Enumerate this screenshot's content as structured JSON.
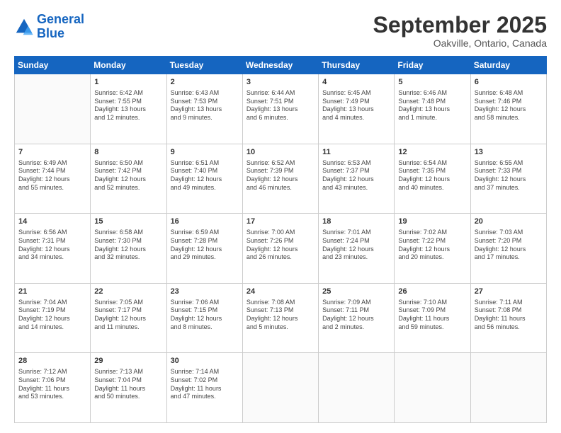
{
  "logo": {
    "line1": "General",
    "line2": "Blue"
  },
  "header": {
    "month": "September 2025",
    "location": "Oakville, Ontario, Canada"
  },
  "weekdays": [
    "Sunday",
    "Monday",
    "Tuesday",
    "Wednesday",
    "Thursday",
    "Friday",
    "Saturday"
  ],
  "weeks": [
    [
      {
        "day": "",
        "content": ""
      },
      {
        "day": "1",
        "content": "Sunrise: 6:42 AM\nSunset: 7:55 PM\nDaylight: 13 hours\nand 12 minutes."
      },
      {
        "day": "2",
        "content": "Sunrise: 6:43 AM\nSunset: 7:53 PM\nDaylight: 13 hours\nand 9 minutes."
      },
      {
        "day": "3",
        "content": "Sunrise: 6:44 AM\nSunset: 7:51 PM\nDaylight: 13 hours\nand 6 minutes."
      },
      {
        "day": "4",
        "content": "Sunrise: 6:45 AM\nSunset: 7:49 PM\nDaylight: 13 hours\nand 4 minutes."
      },
      {
        "day": "5",
        "content": "Sunrise: 6:46 AM\nSunset: 7:48 PM\nDaylight: 13 hours\nand 1 minute."
      },
      {
        "day": "6",
        "content": "Sunrise: 6:48 AM\nSunset: 7:46 PM\nDaylight: 12 hours\nand 58 minutes."
      }
    ],
    [
      {
        "day": "7",
        "content": "Sunrise: 6:49 AM\nSunset: 7:44 PM\nDaylight: 12 hours\nand 55 minutes."
      },
      {
        "day": "8",
        "content": "Sunrise: 6:50 AM\nSunset: 7:42 PM\nDaylight: 12 hours\nand 52 minutes."
      },
      {
        "day": "9",
        "content": "Sunrise: 6:51 AM\nSunset: 7:40 PM\nDaylight: 12 hours\nand 49 minutes."
      },
      {
        "day": "10",
        "content": "Sunrise: 6:52 AM\nSunset: 7:39 PM\nDaylight: 12 hours\nand 46 minutes."
      },
      {
        "day": "11",
        "content": "Sunrise: 6:53 AM\nSunset: 7:37 PM\nDaylight: 12 hours\nand 43 minutes."
      },
      {
        "day": "12",
        "content": "Sunrise: 6:54 AM\nSunset: 7:35 PM\nDaylight: 12 hours\nand 40 minutes."
      },
      {
        "day": "13",
        "content": "Sunrise: 6:55 AM\nSunset: 7:33 PM\nDaylight: 12 hours\nand 37 minutes."
      }
    ],
    [
      {
        "day": "14",
        "content": "Sunrise: 6:56 AM\nSunset: 7:31 PM\nDaylight: 12 hours\nand 34 minutes."
      },
      {
        "day": "15",
        "content": "Sunrise: 6:58 AM\nSunset: 7:30 PM\nDaylight: 12 hours\nand 32 minutes."
      },
      {
        "day": "16",
        "content": "Sunrise: 6:59 AM\nSunset: 7:28 PM\nDaylight: 12 hours\nand 29 minutes."
      },
      {
        "day": "17",
        "content": "Sunrise: 7:00 AM\nSunset: 7:26 PM\nDaylight: 12 hours\nand 26 minutes."
      },
      {
        "day": "18",
        "content": "Sunrise: 7:01 AM\nSunset: 7:24 PM\nDaylight: 12 hours\nand 23 minutes."
      },
      {
        "day": "19",
        "content": "Sunrise: 7:02 AM\nSunset: 7:22 PM\nDaylight: 12 hours\nand 20 minutes."
      },
      {
        "day": "20",
        "content": "Sunrise: 7:03 AM\nSunset: 7:20 PM\nDaylight: 12 hours\nand 17 minutes."
      }
    ],
    [
      {
        "day": "21",
        "content": "Sunrise: 7:04 AM\nSunset: 7:19 PM\nDaylight: 12 hours\nand 14 minutes."
      },
      {
        "day": "22",
        "content": "Sunrise: 7:05 AM\nSunset: 7:17 PM\nDaylight: 12 hours\nand 11 minutes."
      },
      {
        "day": "23",
        "content": "Sunrise: 7:06 AM\nSunset: 7:15 PM\nDaylight: 12 hours\nand 8 minutes."
      },
      {
        "day": "24",
        "content": "Sunrise: 7:08 AM\nSunset: 7:13 PM\nDaylight: 12 hours\nand 5 minutes."
      },
      {
        "day": "25",
        "content": "Sunrise: 7:09 AM\nSunset: 7:11 PM\nDaylight: 12 hours\nand 2 minutes."
      },
      {
        "day": "26",
        "content": "Sunrise: 7:10 AM\nSunset: 7:09 PM\nDaylight: 11 hours\nand 59 minutes."
      },
      {
        "day": "27",
        "content": "Sunrise: 7:11 AM\nSunset: 7:08 PM\nDaylight: 11 hours\nand 56 minutes."
      }
    ],
    [
      {
        "day": "28",
        "content": "Sunrise: 7:12 AM\nSunset: 7:06 PM\nDaylight: 11 hours\nand 53 minutes."
      },
      {
        "day": "29",
        "content": "Sunrise: 7:13 AM\nSunset: 7:04 PM\nDaylight: 11 hours\nand 50 minutes."
      },
      {
        "day": "30",
        "content": "Sunrise: 7:14 AM\nSunset: 7:02 PM\nDaylight: 11 hours\nand 47 minutes."
      },
      {
        "day": "",
        "content": ""
      },
      {
        "day": "",
        "content": ""
      },
      {
        "day": "",
        "content": ""
      },
      {
        "day": "",
        "content": ""
      }
    ]
  ]
}
